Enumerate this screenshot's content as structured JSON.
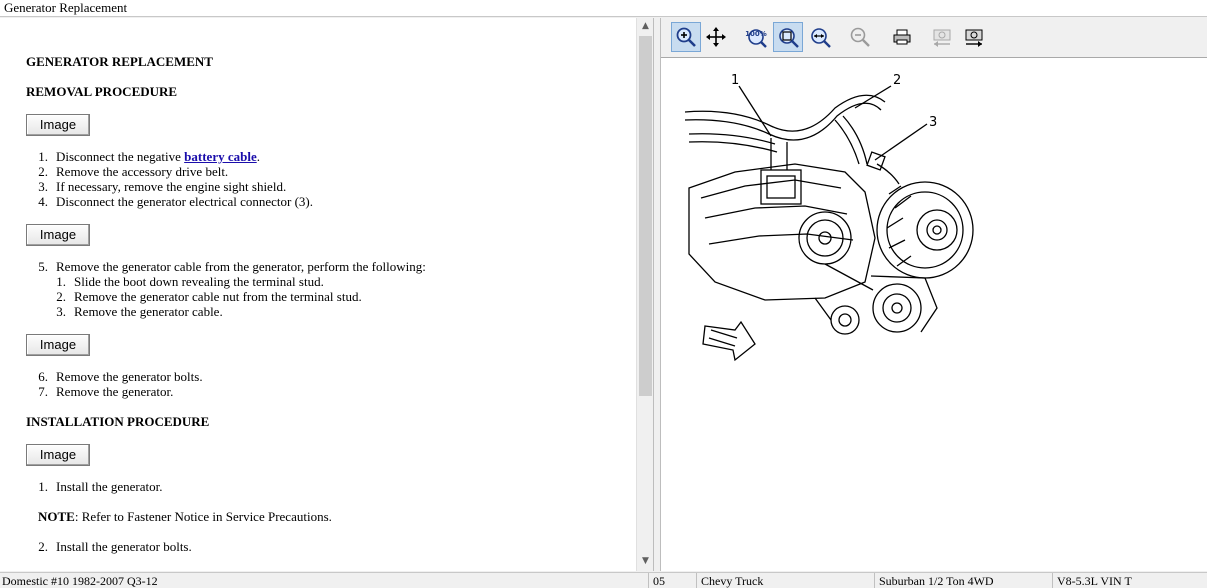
{
  "window": {
    "title": "Generator Replacement"
  },
  "doc": {
    "heading_main": "GENERATOR REPLACEMENT",
    "heading_removal": "REMOVAL PROCEDURE",
    "heading_install": "INSTALLATION PROCEDURE",
    "image_button_label": "Image",
    "removal_steps_a": [
      {
        "num": "1.",
        "pre": "Disconnect the negative ",
        "link": "battery cable",
        "post": "."
      },
      {
        "num": "2.",
        "text": "Remove the accessory drive belt."
      },
      {
        "num": "3.",
        "text": "If necessary, remove the engine sight shield."
      },
      {
        "num": "4.",
        "text": "Disconnect the generator electrical connector (3)."
      }
    ],
    "removal_step_5": {
      "num": "5.",
      "text": "Remove the generator cable from the generator, perform the following:"
    },
    "removal_substeps": [
      {
        "num": "1.",
        "text": "Slide the boot down revealing the terminal stud."
      },
      {
        "num": "2.",
        "text": "Remove the generator cable nut from the terminal stud."
      },
      {
        "num": "3.",
        "text": "Remove the generator cable."
      }
    ],
    "removal_steps_b": [
      {
        "num": "6.",
        "text": "Remove the generator bolts."
      },
      {
        "num": "7.",
        "text": "Remove the generator."
      }
    ],
    "install_step_1": {
      "num": "1.",
      "text": "Install the generator."
    },
    "note": {
      "label": "NOTE",
      "text": ":  Refer to Fastener Notice in Service Precautions."
    },
    "install_step_2": {
      "num": "2.",
      "text": "Install the generator bolts."
    }
  },
  "toolbar": {
    "buttons": [
      {
        "icon": "zoom-in-icon"
      },
      {
        "icon": "pan-icon"
      },
      {
        "icon": "zoom-100-icon",
        "label": "100%"
      },
      {
        "icon": "zoom-fit-icon"
      },
      {
        "icon": "zoom-width-icon"
      },
      {
        "icon": "zoom-out-icon"
      },
      {
        "icon": "print-icon"
      },
      {
        "icon": "previous-image-icon"
      },
      {
        "icon": "next-image-icon"
      }
    ]
  },
  "figure": {
    "callouts": [
      "1",
      "2",
      "3"
    ]
  },
  "status": {
    "database": "Domestic #10 1982-2007 Q3-12",
    "year": "05",
    "make": "Chevy Truck",
    "model": "Suburban 1/2 Ton 4WD",
    "engine": "V8-5.3L VIN T"
  }
}
